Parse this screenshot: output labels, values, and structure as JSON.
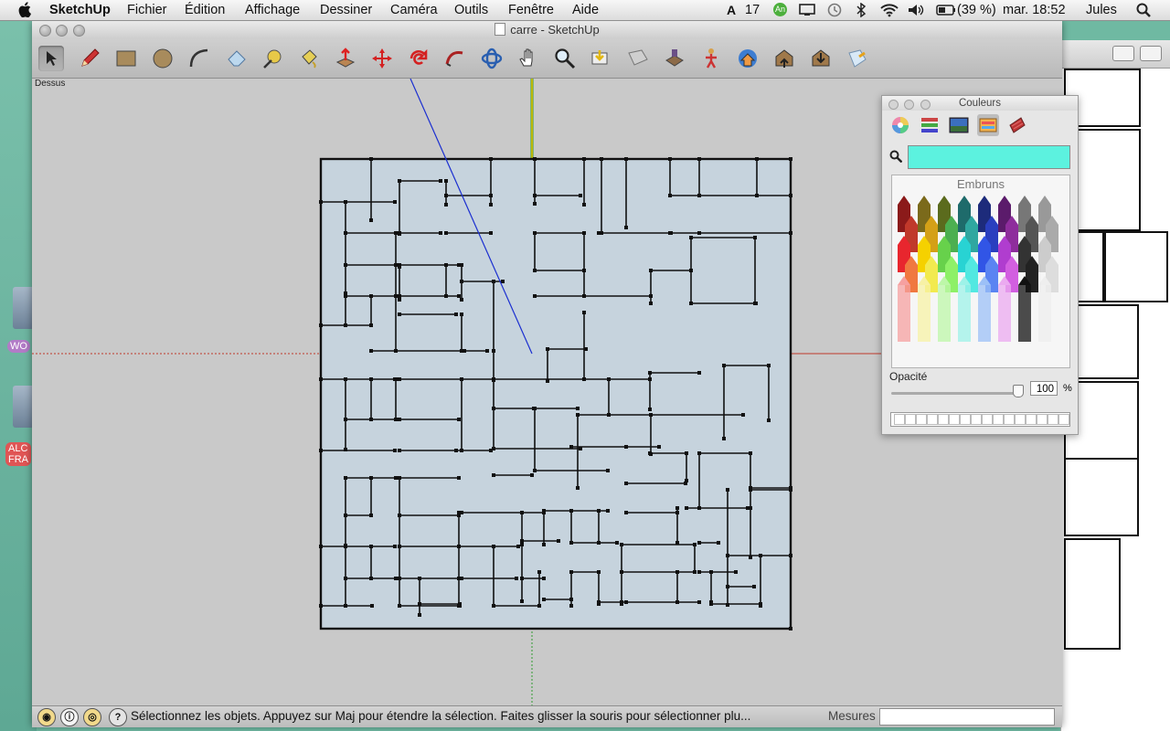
{
  "menubar": {
    "app_name": "SketchUp",
    "items": [
      "Fichier",
      "Édition",
      "Affichage",
      "Dessiner",
      "Caméra",
      "Outils",
      "Fenêtre",
      "Aide"
    ],
    "adobe_count": "17",
    "battery": "(39 %)",
    "clock": "mar. 18:52",
    "user": "Jules"
  },
  "window": {
    "title": "carre - SketchUp",
    "view_label": "Dessus"
  },
  "toolbar": {
    "tools": [
      "select-tool-icon",
      "pencil-icon",
      "rectangle-icon",
      "circle-icon",
      "arc-icon",
      "eraser-icon",
      "tape-measure-icon",
      "paint-bucket-icon",
      "push-pull-icon",
      "move-icon",
      "rotate-icon",
      "follow-me-icon",
      "orbit-icon",
      "pan-icon",
      "zoom-icon",
      "zoom-window-icon",
      "previous-view-icon",
      "position-camera-icon",
      "walk-icon",
      "get-models-icon",
      "share-model-icon",
      "components-icon",
      "send-to-layout-icon"
    ]
  },
  "desktop": {
    "label1": "WO",
    "label2a": "ALC",
    "label2b": "FRA"
  },
  "colors_panel": {
    "title": "Couleurs",
    "selected_color": "#5cf2df",
    "palette_name": "Embruns",
    "opacity_label": "Opacité",
    "opacity_value": "100",
    "opacity_unit": "%"
  },
  "status": {
    "message": "Sélectionnez les objets. Appuyez sur Maj pour étendre la sélection. Faites glisser la souris pour sélectionner plu...",
    "measure_label": "Mesures",
    "measure_value": ""
  }
}
